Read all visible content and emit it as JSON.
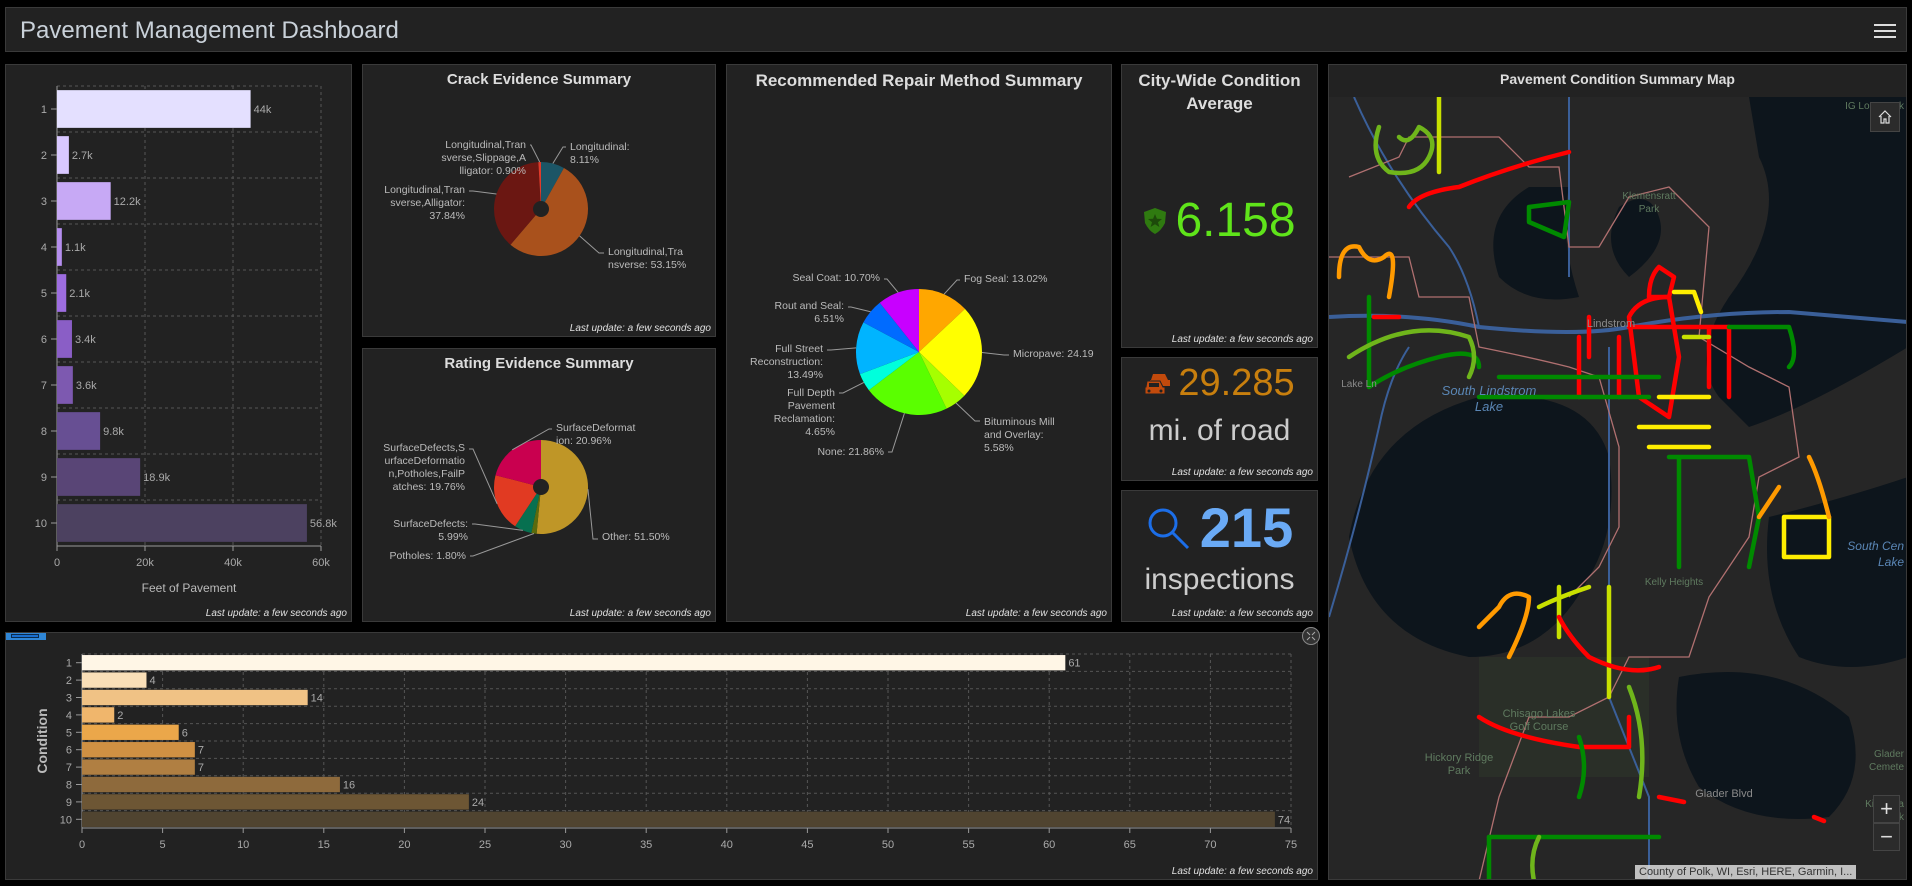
{
  "header": {
    "title": "Pavement Management Dashboard",
    "menu_icon": "hamburger-menu-icon"
  },
  "footer_text": "Last update: a few seconds ago",
  "feet_chart": {
    "chart_data": {
      "type": "bar",
      "orientation": "horizontal",
      "categories": [
        "1",
        "2",
        "3",
        "4",
        "5",
        "6",
        "7",
        "8",
        "9",
        "10"
      ],
      "values": [
        44000,
        2700,
        12200,
        1100,
        2100,
        3400,
        3600,
        9800,
        18900,
        56800
      ],
      "labels": [
        "44k",
        "2.7k",
        "12.2k",
        "1.1k",
        "2.1k",
        "3.4k",
        "3.6k",
        "9.8k",
        "18.9k",
        "56.8k"
      ],
      "xlabel": "Feet of Pavement",
      "ylabel": "",
      "xlim": [
        0,
        60000
      ],
      "xticks": [
        "0",
        "20k",
        "40k",
        "60k"
      ],
      "grid": true,
      "colors": [
        "#e4e0ff",
        "#d9c8ff",
        "#c7a9f5",
        "#b58eee",
        "#9d6de0",
        "#8a5ec6",
        "#7d59b0",
        "#674f93",
        "#594576",
        "#4c4160"
      ]
    }
  },
  "crack_chart": {
    "title": "Crack Evidence Summary",
    "chart_data": {
      "type": "pie",
      "title": "Crack Evidence Summary",
      "slices": [
        {
          "label": "Longitudinal",
          "label_lines": [
            "Longitudinal:",
            "8.11%"
          ],
          "value": 8.11,
          "color": "#1c5566"
        },
        {
          "label": "Longitudinal,Transverse",
          "label_lines": [
            "Longitudinal,Tra",
            "nsverse: 53.15%"
          ],
          "value": 53.15,
          "color": "#a9511c"
        },
        {
          "label": "Longitudinal,Transverse,Alligator",
          "label_lines": [
            "Longitudinal,Tran",
            "sverse,Alligator:",
            "37.84%"
          ],
          "value": 37.84,
          "color": "#6b1712"
        },
        {
          "label": "Longitudinal,Transverse,Slippage,Alligator",
          "label_lines": [
            "Longitudinal,Tran",
            "sverse,Slippage,A",
            "lligator: 0.90%"
          ],
          "value": 0.9,
          "color": "#e03a2a"
        }
      ]
    }
  },
  "rating_chart": {
    "title": "Rating Evidence Summary",
    "chart_data": {
      "type": "pie",
      "title": "Rating Evidence Summary",
      "slices": [
        {
          "label": "Other",
          "label_lines": [
            "Other: 51.50%"
          ],
          "value": 51.5,
          "color": "#bf9627"
        },
        {
          "label": "Potholes",
          "label_lines": [
            "Potholes: 1.80%"
          ],
          "value": 1.8,
          "color": "#5b6b0d"
        },
        {
          "label": "SurfaceDefects",
          "label_lines": [
            "SurfaceDefects:",
            "5.99%"
          ],
          "value": 5.99,
          "color": "#077050"
        },
        {
          "label": "SurfaceDefects,SurfaceDeformation,Potholes,FailPatches",
          "label_lines": [
            "SurfaceDefects,S",
            "urfaceDeformatio",
            "n,Potholes,FailP",
            "atches: 19.76%"
          ],
          "value": 19.76,
          "color": "#e13a22"
        },
        {
          "label": "SurfaceDeformation",
          "label_lines": [
            "SurfaceDeformat",
            "ion: 20.96%"
          ],
          "value": 20.96,
          "color": "#c9004f"
        }
      ]
    }
  },
  "repair_chart": {
    "title": "Recommended Repair Method Summary",
    "chart_data": {
      "type": "pie",
      "title": "Recommended Repair Method Summary",
      "slices": [
        {
          "label": "Fog Seal",
          "label_lines": [
            "Fog Seal: 13.02%"
          ],
          "value": 13.02,
          "color": "#ffa700"
        },
        {
          "label": "Micropave",
          "label_lines": [
            "Micropave: 24.19"
          ],
          "value": 24.19,
          "color": "#ffff00"
        },
        {
          "label": "Bituminous Mill and Overlay",
          "label_lines": [
            "Bituminous Mill",
            "and Overlay:",
            "5.58%"
          ],
          "value": 5.58,
          "color": "#a6ff00"
        },
        {
          "label": "None",
          "label_lines": [
            "None: 21.86%"
          ],
          "value": 21.86,
          "color": "#5aff00"
        },
        {
          "label": "Full Depth Pavement Reclamation",
          "label_lines": [
            "Full Depth",
            "Pavement",
            "Reclamation:",
            "4.65%"
          ],
          "value": 4.65,
          "color": "#00ffdc"
        },
        {
          "label": "Full Street Reconstruction",
          "label_lines": [
            "Full Street",
            "Reconstruction:",
            "13.49%"
          ],
          "value": 13.49,
          "color": "#00b4ff"
        },
        {
          "label": "Rout and Seal",
          "label_lines": [
            "Rout and Seal:",
            "6.51%"
          ],
          "value": 6.51,
          "color": "#006bff"
        },
        {
          "label": "Seal Coat",
          "label_lines": [
            "Seal Coat: 10.70%"
          ],
          "value": 10.7,
          "color": "#c800ff"
        }
      ]
    }
  },
  "condition_avg": {
    "title_line1": "City-Wide Condition",
    "title_line2": "Average",
    "value": "6.158",
    "icon": "shield-star-icon",
    "color": "#5fe41a"
  },
  "road_miles": {
    "value": "29.285",
    "label": "mi. of road",
    "icon": "car-icon",
    "color": "#c87f0e",
    "icon_color": "#c24a0c"
  },
  "inspections": {
    "value": "215",
    "label": "inspections",
    "icon": "search-icon",
    "color": "#6aaaf5",
    "icon_color": "#1c6ee8"
  },
  "condition_chart": {
    "chart_data": {
      "type": "bar",
      "orientation": "horizontal",
      "categories": [
        "1",
        "2",
        "3",
        "4",
        "5",
        "6",
        "7",
        "8",
        "9",
        "10"
      ],
      "values": [
        61,
        4,
        14,
        2,
        6,
        7,
        7,
        16,
        24,
        74
      ],
      "ylabel": "Condition",
      "xlabel": "",
      "xlim": [
        0,
        75
      ],
      "xticks": [
        "0",
        "5",
        "10",
        "15",
        "20",
        "25",
        "30",
        "35",
        "40",
        "45",
        "50",
        "55",
        "60",
        "65",
        "70",
        "75"
      ],
      "grid": true,
      "colors": [
        "#fff6e6",
        "#f9dfb8",
        "#f0c285",
        "#f0b66c",
        "#eba74a",
        "#cf9043",
        "#b07f42",
        "#8e6a3c",
        "#6d5634",
        "#504430"
      ]
    }
  },
  "map": {
    "title": "Pavement Condition Summary Map",
    "attribution": "County of Polk, WI, Esri, HERE, Garmin, I...",
    "home_icon": "home-icon",
    "zoom_in": "+",
    "zoom_out": "−",
    "labels": [
      {
        "text": "South Lindstrom",
        "kind": "water"
      },
      {
        "text": "Lake",
        "kind": "water"
      },
      {
        "text": "South Cen",
        "kind": "water"
      },
      {
        "text": "Lake",
        "kind": "water"
      },
      {
        "text": "Lindstrom",
        "kind": "place"
      },
      {
        "text": "Chisago Lakes",
        "kind": "park"
      },
      {
        "text": "Golf Course",
        "kind": "park"
      },
      {
        "text": "Hickory Ridge",
        "kind": "park"
      },
      {
        "text": "Park",
        "kind": "park"
      },
      {
        "text": "Glader Blvd",
        "kind": "road"
      },
      {
        "text": "Lake Ln",
        "kind": "road"
      },
      {
        "text": "Kelly Heights",
        "kind": "park"
      },
      {
        "text": "Glader",
        "kind": "park"
      },
      {
        "text": "Cemete",
        "kind": "park"
      },
      {
        "text": "Ki-chi-sa",
        "kind": "park"
      },
      {
        "text": "Park",
        "kind": "park"
      },
      {
        "text": "Klemensratt",
        "kind": "park"
      },
      {
        "text": "Park",
        "kind": "park"
      },
      {
        "text": "IG Lone Park",
        "kind": "park"
      }
    ],
    "condition_colors": {
      "good": "#008a00",
      "fair_good": "#6fb51b",
      "fair": "#c8e000",
      "mid": "#ffee00",
      "poor": "#ff9a00",
      "bad": "#ff0000"
    }
  }
}
